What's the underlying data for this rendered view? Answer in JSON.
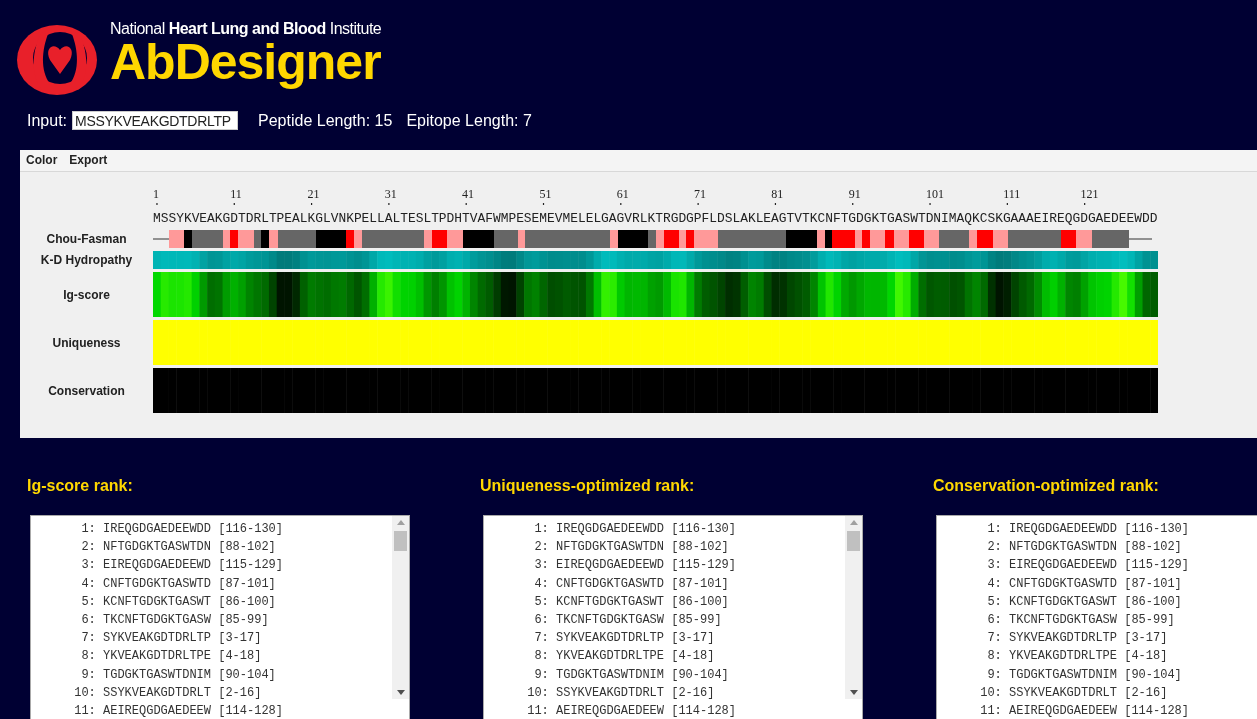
{
  "header": {
    "institute": "National **Heart Lung and Blood** Institute",
    "app_name": "AbDesigner"
  },
  "input": {
    "label": "Input:",
    "value": "MSSYKVEAKGDTDRLTP"
  },
  "peptide_length": "Peptide Length: 15",
  "epitope_length": "Epitope Length: 7",
  "menu": [
    "Color",
    "Export"
  ],
  "sequence_view": {
    "position_ticks": [
      "1",
      "11",
      "21",
      "31",
      "41",
      "51",
      "61",
      "71",
      "81",
      "91",
      "101",
      "111",
      "121"
    ],
    "sequence": "MSSYKVEAKGDTDRLTPEALKGLVNKPELLALTESLTPDHTVAFWMPESEMEVMELELGAGVRLKTRGDGPFLDSLAKLEAGTVTKCNFTGDGKTGASWTDNIMAQKCSKGAAAEIREQGDGAEDEEWDD",
    "tracks": [
      {
        "label": "Chou-Fasman",
        "kind": "secondary"
      },
      {
        "label": "K-D Hydropathy",
        "kind": "hydropathy"
      },
      {
        "label": "Ig-score",
        "kind": "igscore"
      },
      {
        "label": "Uniqueness",
        "kind": "uniqueness"
      },
      {
        "label": "Conservation",
        "kind": "conservation"
      }
    ]
  },
  "rankings": [
    {
      "title": "Ig-score rank:",
      "scrollbar": true,
      "items": [
        {
          "rank": "1:",
          "peptide": "IREQGDGAEDEEWDD",
          "range": "[116-130]"
        },
        {
          "rank": "2:",
          "peptide": "NFTGDGKTGASWTDN",
          "range": "[88-102]"
        },
        {
          "rank": "3:",
          "peptide": "EIREQGDGAEDEEWD",
          "range": "[115-129]"
        },
        {
          "rank": "4:",
          "peptide": "CNFTGDGKTGASWTD",
          "range": "[87-101]"
        },
        {
          "rank": "5:",
          "peptide": "KCNFTGDGKTGASWT",
          "range": "[86-100]"
        },
        {
          "rank": "6:",
          "peptide": "TKCNFTGDGKTGASW",
          "range": "[85-99]"
        },
        {
          "rank": "7:",
          "peptide": "SYKVEAKGDTDRLTP",
          "range": "[3-17]"
        },
        {
          "rank": "8:",
          "peptide": "YKVEAKGDTDRLTPE",
          "range": "[4-18]"
        },
        {
          "rank": "9:",
          "peptide": "TGDGKTGASWTDNIM",
          "range": "[90-104]"
        },
        {
          "rank": "10:",
          "peptide": "SSYKVEAKGDTDRLT",
          "range": "[2-16]"
        },
        {
          "rank": "11:",
          "peptide": "AEIREQGDGAEDEEW",
          "range": "[114-128]"
        }
      ]
    },
    {
      "title": "Uniqueness-optimized rank:",
      "scrollbar": true,
      "items": [
        {
          "rank": "1:",
          "peptide": "IREQGDGAEDEEWDD",
          "range": "[116-130]"
        },
        {
          "rank": "2:",
          "peptide": "NFTGDGKTGASWTDN",
          "range": "[88-102]"
        },
        {
          "rank": "3:",
          "peptide": "EIREQGDGAEDEEWD",
          "range": "[115-129]"
        },
        {
          "rank": "4:",
          "peptide": "CNFTGDGKTGASWTD",
          "range": "[87-101]"
        },
        {
          "rank": "5:",
          "peptide": "KCNFTGDGKTGASWT",
          "range": "[86-100]"
        },
        {
          "rank": "6:",
          "peptide": "TKCNFTGDGKTGASW",
          "range": "[85-99]"
        },
        {
          "rank": "7:",
          "peptide": "SYKVEAKGDTDRLTP",
          "range": "[3-17]"
        },
        {
          "rank": "8:",
          "peptide": "YKVEAKGDTDRLTPE",
          "range": "[4-18]"
        },
        {
          "rank": "9:",
          "peptide": "TGDGKTGASWTDNIM",
          "range": "[90-104]"
        },
        {
          "rank": "10:",
          "peptide": "SSYKVEAKGDTDRLT",
          "range": "[2-16]"
        },
        {
          "rank": "11:",
          "peptide": "AEIREQGDGAEDEEW",
          "range": "[114-128]"
        }
      ]
    },
    {
      "title": "Conservation-optimized rank:",
      "scrollbar": false,
      "items": [
        {
          "rank": "1:",
          "peptide": "IREQGDGAEDEEWDD",
          "range": "[116-130]"
        },
        {
          "rank": "2:",
          "peptide": "NFTGDGKTGASWTDN",
          "range": "[88-102]"
        },
        {
          "rank": "3:",
          "peptide": "EIREQGDGAEDEEWD",
          "range": "[115-129]"
        },
        {
          "rank": "4:",
          "peptide": "CNFTGDGKTGASWTD",
          "range": "[87-101]"
        },
        {
          "rank": "5:",
          "peptide": "KCNFTGDGKTGASWT",
          "range": "[86-100]"
        },
        {
          "rank": "6:",
          "peptide": "TKCNFTGDGKTGASW",
          "range": "[85-99]"
        },
        {
          "rank": "7:",
          "peptide": "SYKVEAKGDTDRLTP",
          "range": "[3-17]"
        },
        {
          "rank": "8:",
          "peptide": "YKVEAKGDTDRLTPE",
          "range": "[4-18]"
        },
        {
          "rank": "9:",
          "peptide": "TGDGKTGASWTDNIM",
          "range": "[90-104]"
        },
        {
          "rank": "10:",
          "peptide": "SSYKVEAKGDTDRLT",
          "range": "[2-16]"
        },
        {
          "rank": "11:",
          "peptide": "AEIREQGDGAEDEEW",
          "range": "[114-128]"
        }
      ]
    }
  ]
}
